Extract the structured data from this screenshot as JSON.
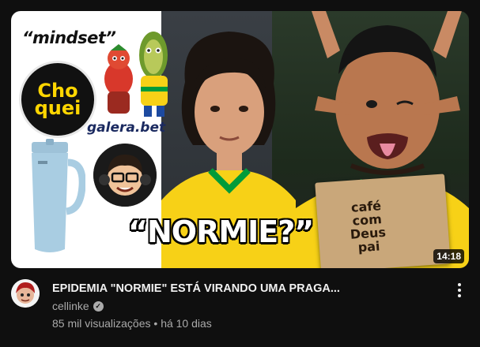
{
  "thumbnail": {
    "duration": "14:18",
    "overlay_text": "“NORMIE?”",
    "mindset_text": "“mindset”",
    "choquei_line1": "Cho",
    "choquei_line2": "quei",
    "galera_text": "galera.bet",
    "cafe_line1": "café",
    "cafe_line2": "com",
    "cafe_line3": "Deus",
    "cafe_line4": "pai"
  },
  "video": {
    "title": "EPIDEMIA \"NORMIE\" ESTÁ VIRANDO UMA PRAGA...",
    "channel_name": "cellinke",
    "views": "85 mil visualizações",
    "separator": "•",
    "published": "há 10 dias"
  },
  "colors": {
    "background": "#0f0f0f",
    "primary_text": "#f1f1f1",
    "secondary_text": "#aaaaaa",
    "brazil_yellow": "#f7d117",
    "brazil_green": "#009b3a"
  }
}
